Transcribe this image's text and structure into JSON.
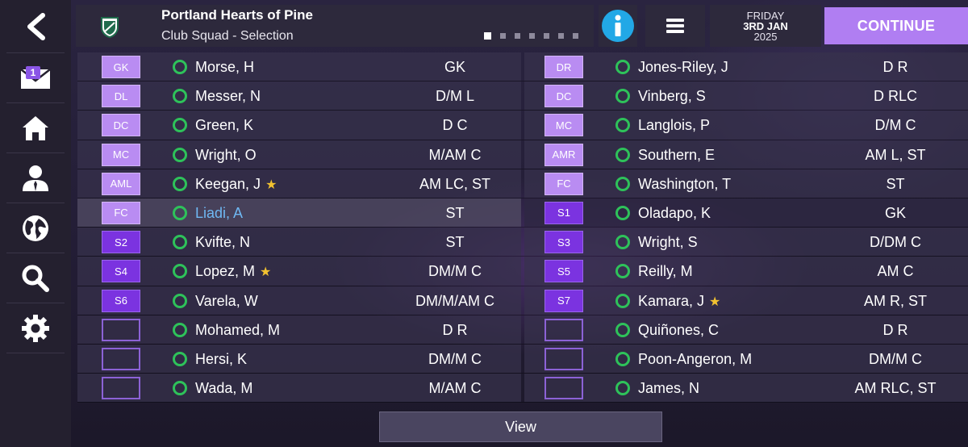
{
  "header": {
    "club_name": "Portland Hearts of Pine",
    "subtitle": "Club Squad - Selection",
    "date_day": "FRIDAY",
    "date_main": "3RD JAN",
    "date_year": "2025",
    "continue_label": "CONTINUE",
    "page_dots": 7,
    "active_dot": 0
  },
  "sidebar": {
    "mail_badge": "1",
    "items": [
      "back-icon",
      "mail-icon",
      "home-icon",
      "person-icon",
      "globe-icon",
      "search-icon",
      "gear-icon"
    ]
  },
  "colors": {
    "accent": "#b07ef2",
    "sub_slot": "#7b33e0",
    "status_ok": "#2ec25a",
    "selected_name": "#6fb8f3",
    "star": "#f2c230"
  },
  "left": [
    {
      "slot": "GK",
      "name": "Morse, H",
      "pos": "GK",
      "star": false,
      "type": "start"
    },
    {
      "slot": "DL",
      "name": "Messer, N",
      "pos": "D/M L",
      "star": false,
      "type": "start"
    },
    {
      "slot": "DC",
      "name": "Green, K",
      "pos": "D C",
      "star": false,
      "type": "start"
    },
    {
      "slot": "MC",
      "name": "Wright, O",
      "pos": "M/AM C",
      "star": false,
      "type": "start"
    },
    {
      "slot": "AML",
      "name": "Keegan, J",
      "pos": "AM LC, ST",
      "star": true,
      "type": "start"
    },
    {
      "slot": "FC",
      "name": "Liadi, A",
      "pos": "ST",
      "star": false,
      "type": "start",
      "selected": true
    },
    {
      "slot": "S2",
      "name": "Kvifte, N",
      "pos": "ST",
      "star": false,
      "type": "sub"
    },
    {
      "slot": "S4",
      "name": "Lopez, M",
      "pos": "DM/M C",
      "star": true,
      "type": "sub"
    },
    {
      "slot": "S6",
      "name": "Varela, W",
      "pos": "DM/M/AM C",
      "star": false,
      "type": "sub"
    },
    {
      "slot": "",
      "name": "Mohamed, M",
      "pos": "D R",
      "star": false,
      "type": "empty"
    },
    {
      "slot": "",
      "name": "Hersi, K",
      "pos": "DM/M C",
      "star": false,
      "type": "empty"
    },
    {
      "slot": "",
      "name": "Wada, M",
      "pos": "M/AM C",
      "star": false,
      "type": "empty"
    }
  ],
  "right": [
    {
      "slot": "DR",
      "name": "Jones-Riley, J",
      "pos": "D R",
      "star": false,
      "type": "start"
    },
    {
      "slot": "DC",
      "name": "Vinberg, S",
      "pos": "D RLC",
      "star": false,
      "type": "start"
    },
    {
      "slot": "MC",
      "name": "Langlois, P",
      "pos": "D/M C",
      "star": false,
      "type": "start"
    },
    {
      "slot": "AMR",
      "name": "Southern, E",
      "pos": "AM L, ST",
      "star": false,
      "type": "start"
    },
    {
      "slot": "FC",
      "name": "Washington, T",
      "pos": "ST",
      "star": false,
      "type": "start"
    },
    {
      "slot": "S1",
      "name": "Oladapo, K",
      "pos": "GK",
      "star": false,
      "type": "sub"
    },
    {
      "slot": "S3",
      "name": "Wright, S",
      "pos": "D/DM C",
      "star": false,
      "type": "sub"
    },
    {
      "slot": "S5",
      "name": "Reilly, M",
      "pos": "AM C",
      "star": false,
      "type": "sub"
    },
    {
      "slot": "S7",
      "name": "Kamara, J",
      "pos": "AM R, ST",
      "star": true,
      "type": "sub"
    },
    {
      "slot": "",
      "name": "Quiñones, C",
      "pos": "D R",
      "star": false,
      "type": "empty"
    },
    {
      "slot": "",
      "name": "Poon-Angeron, M",
      "pos": "DM/M C",
      "star": false,
      "type": "empty"
    },
    {
      "slot": "",
      "name": "James, N",
      "pos": "AM RLC, ST",
      "star": false,
      "type": "empty"
    }
  ],
  "footer": {
    "view_label": "View"
  }
}
